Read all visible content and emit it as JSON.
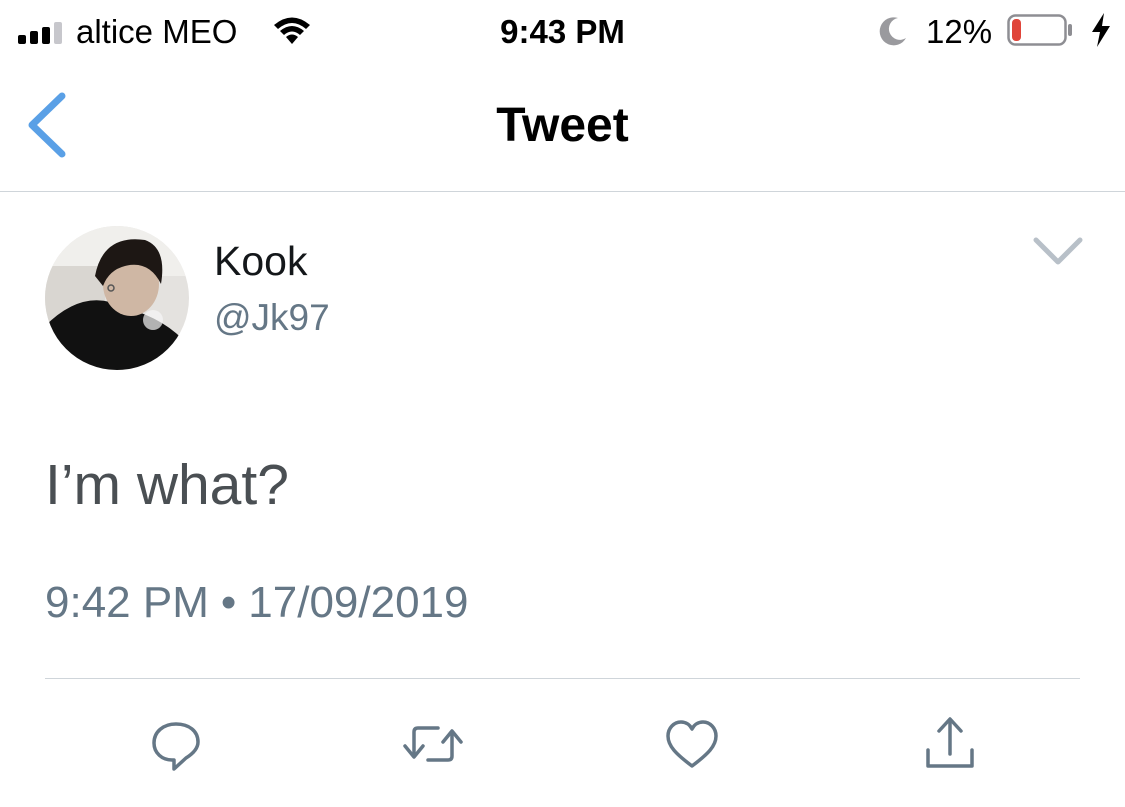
{
  "status_bar": {
    "carrier": "altice MEO",
    "time": "9:43 PM",
    "battery_percent": "12%",
    "battery_level": 0.12,
    "battery_color": "#e0453a"
  },
  "nav": {
    "title": "Tweet",
    "back_icon": "chevron-left-icon",
    "accent": "#5aa0e6"
  },
  "tweet": {
    "author_name": "Kook",
    "author_handle": "@Jk97",
    "text": "I’m what?",
    "time": "9:42 PM",
    "separator": "•",
    "date": "17/09/2019"
  },
  "actions": [
    {
      "icon": "reply-icon"
    },
    {
      "icon": "retweet-icon"
    },
    {
      "icon": "like-icon"
    },
    {
      "icon": "share-icon"
    }
  ],
  "colors": {
    "icon_gray": "#657786",
    "divider": "#cfd5da",
    "text_dark": "#14171a"
  }
}
